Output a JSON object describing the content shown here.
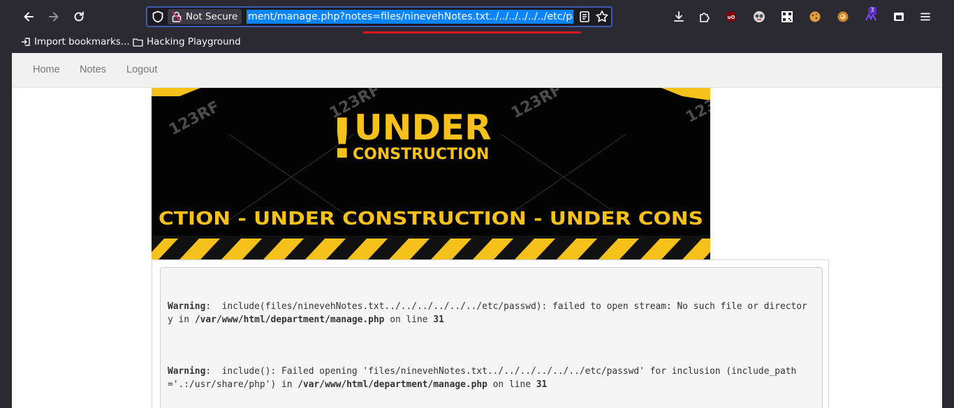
{
  "toolbar": {
    "back_icon": "arrow-left-icon",
    "forward_icon": "arrow-right-icon",
    "reload_icon": "reload-icon",
    "not_secure_label": "Not Secure",
    "url": "ment/manage.php?notes=files/ninevehNotes.txt../../../../../../etc/passwd",
    "extension_badge": "3"
  },
  "bookmarks": {
    "import_label": "Import bookmarks...",
    "folder_label": "Hacking Playground"
  },
  "site_nav": {
    "home": "Home",
    "notes": "Notes",
    "logout": "Logout"
  },
  "banner": {
    "exclamation": "!",
    "title": "UNDER",
    "subtitle": "CONSTRUCTION",
    "strip": "CTION - UNDER  CONSTRUCTION - UNDER  CONS",
    "watermark": "123RF"
  },
  "warnings": [
    {
      "label": "Warning",
      "line1_text": ":  include(files/ninevehNotes.txt../../../../../../etc/passwd): failed to open stream: No such file or director",
      "line2_prefix": "y in ",
      "path": "/var/www/html/department/manage.php",
      "line_word": " on line ",
      "line_no": "31"
    },
    {
      "label": "Warning",
      "line1_text": ":  include(): Failed opening 'files/ninevehNotes.txt../../../../../../etc/passwd' for inclusion (include_path",
      "line2_prefix": "='.:/usr/share/php') in ",
      "path": "/var/www/html/department/manage.php",
      "line_word": " on line ",
      "line_no": "31"
    }
  ],
  "colors": {
    "chrome_bg": "#2b2a33",
    "url_highlight": "#0a84ff",
    "annotation_red": "#e0181e",
    "banner_yellow": "#f7c11c"
  }
}
